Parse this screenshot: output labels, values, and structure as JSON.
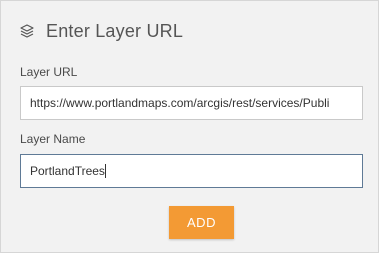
{
  "header": {
    "icon": "layers-icon",
    "title": "Enter Layer URL"
  },
  "layer_url": {
    "label": "Layer URL",
    "value": "https://www.portlandmaps.com/arcgis/rest/services/Publi"
  },
  "layer_name": {
    "label": "Layer Name",
    "value": "PortlandTrees"
  },
  "actions": {
    "add_label": "ADD"
  },
  "colors": {
    "panel_background": "#f2f2f2",
    "accent_button": "#f39a34",
    "focused_border": "#5f7a96"
  }
}
